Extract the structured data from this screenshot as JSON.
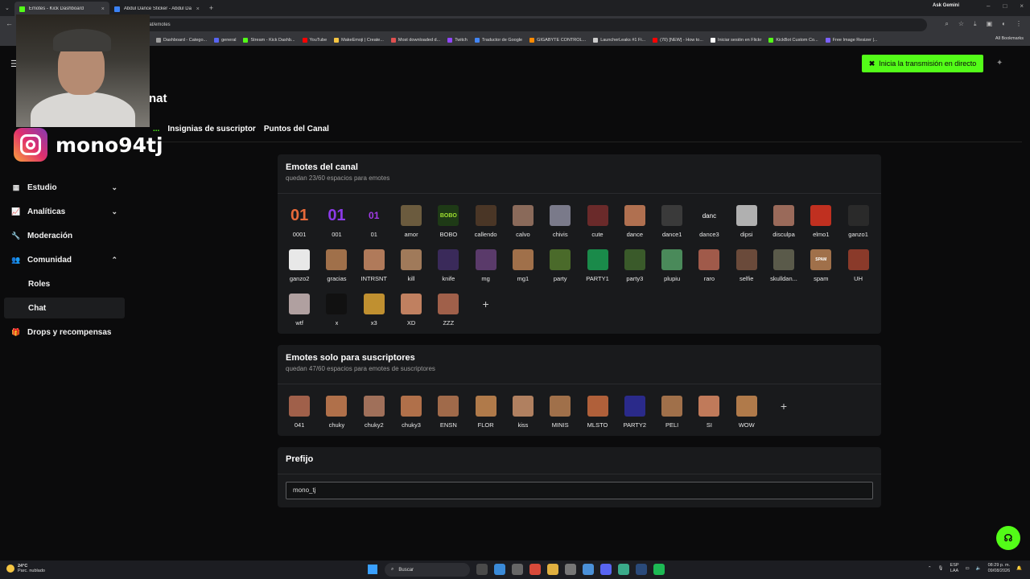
{
  "browser": {
    "tabs": [
      {
        "title": "Emotes - Kick Dashboard",
        "active": true,
        "color": "#53fc18"
      },
      {
        "title": "Abdul Dance Sticker - Abdul Da",
        "active": false,
        "color": "#3b82f6"
      }
    ],
    "new_tab": "+",
    "gemini": "Ask Gemini",
    "url": "hat/emotes",
    "bookmarks": [
      {
        "label": "Dashboard - Catego...",
        "color": "#9e9e9e"
      },
      {
        "label": "general",
        "color": "#5865f2"
      },
      {
        "label": "Stream - Kick Dashb...",
        "color": "#53fc18"
      },
      {
        "label": "YouTube",
        "color": "#ff0000"
      },
      {
        "label": "MakeEmoji | Create...",
        "color": "#f5c542"
      },
      {
        "label": "Most downloaded d...",
        "color": "#e05050"
      },
      {
        "label": "Twitch",
        "color": "#9146ff"
      },
      {
        "label": "Traductor de Google",
        "color": "#4285f4"
      },
      {
        "label": "GIGABYTE CONTROL...",
        "color": "#ff8a00"
      },
      {
        "label": "LauncherLeaks #1 Fi...",
        "color": "#cccccc"
      },
      {
        "label": "(70) [NEW] - How to...",
        "color": "#ff0000"
      },
      {
        "label": "Iniciar sesión en Flickr",
        "color": "#ffffff"
      },
      {
        "label": "KickBot Custom Co...",
        "color": "#53fc18"
      },
      {
        "label": "Free Image Resizer |...",
        "color": "#7b61ff"
      }
    ],
    "all_bookmarks": "All Bookmarks"
  },
  "header": {
    "live_button": "Inicia la transmisión en directo",
    "page_title": "nat"
  },
  "overlay": {
    "instagram_handle": "mono94tj"
  },
  "subtabs": [
    "...",
    "Insignias de suscriptor",
    "Puntos del Canal"
  ],
  "sidebar": {
    "items": [
      {
        "label": "Estudio",
        "icon": "studio-icon",
        "chevron": "⌄"
      },
      {
        "label": "Analíticas",
        "icon": "analytics-icon",
        "chevron": "⌄"
      },
      {
        "label": "Moderación",
        "icon": "wrench-icon",
        "chevron": ""
      },
      {
        "label": "Comunidad",
        "icon": "community-icon",
        "chevron": "⌃"
      }
    ],
    "sub_items": [
      {
        "label": "Roles",
        "active": false
      },
      {
        "label": "Chat",
        "active": true
      }
    ],
    "drops": {
      "label": "Drops y recompensas",
      "icon": "gift-icon"
    }
  },
  "channel_emotes": {
    "title": "Emotes del canal",
    "subtitle": "quedan 23/60 espacios para emotes",
    "items": [
      {
        "label": "0001",
        "glyph": "01",
        "color": "#e86a3a"
      },
      {
        "label": "001",
        "glyph": "01",
        "color": "#8b3ae8"
      },
      {
        "label": "01",
        "glyph": "01",
        "color": "#a23ae8"
      },
      {
        "label": "amor",
        "glyph": "",
        "color": "#6b5b3e"
      },
      {
        "label": "BOBO",
        "glyph": "BOBO",
        "color": "#1e3a16"
      },
      {
        "label": "callendo",
        "glyph": "",
        "color": "#4a3626"
      },
      {
        "label": "calvo",
        "glyph": "",
        "color": "#8a6a5a"
      },
      {
        "label": "chivis",
        "glyph": "",
        "color": "#7a7a8a"
      },
      {
        "label": "cute",
        "glyph": "",
        "color": "#6a2a2a"
      },
      {
        "label": "dance",
        "glyph": "",
        "color": "#b07050"
      },
      {
        "label": "dance1",
        "glyph": "",
        "color": "#3a3a3a"
      },
      {
        "label": "dance3",
        "glyph": "danc",
        "color": "#191a1c"
      },
      {
        "label": "dipsi",
        "glyph": "",
        "color": "#b0b0b0"
      },
      {
        "label": "disculpa",
        "glyph": "",
        "color": "#9a6a5a"
      },
      {
        "label": "elmo1",
        "glyph": "",
        "color": "#c03020"
      },
      {
        "label": "ganzo1",
        "glyph": "",
        "color": "#2a2a2a"
      },
      {
        "label": "ganzo2",
        "glyph": "",
        "color": "#e8e8e8"
      },
      {
        "label": "gracias",
        "glyph": "",
        "color": "#a0704a"
      },
      {
        "label": "INTRSNT",
        "glyph": "",
        "color": "#b07a5a"
      },
      {
        "label": "kill",
        "glyph": "",
        "color": "#a07a5a"
      },
      {
        "label": "knife",
        "glyph": "",
        "color": "#3a2a5a"
      },
      {
        "label": "mg",
        "glyph": "",
        "color": "#5a3a6a"
      },
      {
        "label": "mg1",
        "glyph": "",
        "color": "#a0704a"
      },
      {
        "label": "party",
        "glyph": "",
        "color": "#4a6a2a"
      },
      {
        "label": "PARTY1",
        "glyph": "",
        "color": "#1a8a4a"
      },
      {
        "label": "party3",
        "glyph": "",
        "color": "#3a5a2a"
      },
      {
        "label": "plupiu",
        "glyph": "",
        "color": "#4a8a5a"
      },
      {
        "label": "raro",
        "glyph": "",
        "color": "#a05a4a"
      },
      {
        "label": "selfie",
        "glyph": "",
        "color": "#6a4a3a"
      },
      {
        "label": "skulldan...",
        "glyph": "",
        "color": "#5a5a4a"
      },
      {
        "label": "spam",
        "glyph": "SPAM",
        "color": "#a0704a"
      },
      {
        "label": "UH",
        "glyph": "",
        "color": "#8a3a2a"
      },
      {
        "label": "wtf",
        "glyph": "",
        "color": "#b0a0a0"
      },
      {
        "label": "x",
        "glyph": "",
        "color": "#111111"
      },
      {
        "label": "x3",
        "glyph": "",
        "color": "#c09030"
      },
      {
        "label": "XD",
        "glyph": "",
        "color": "#c08060"
      },
      {
        "label": "ZZZ",
        "glyph": "",
        "color": "#a0604a"
      }
    ],
    "add": "+"
  },
  "sub_emotes": {
    "title": "Emotes solo para suscriptores",
    "subtitle": "quedan 47/60 espacios para emotes de suscriptores",
    "items": [
      {
        "label": "041",
        "glyph": "",
        "color": "#a0604a"
      },
      {
        "label": "chuky",
        "glyph": "",
        "color": "#b0704a"
      },
      {
        "label": "chuky2",
        "glyph": "",
        "color": "#a0705a"
      },
      {
        "label": "chuky3",
        "glyph": "",
        "color": "#b0704a"
      },
      {
        "label": "ENSN",
        "glyph": "",
        "color": "#a06a4a"
      },
      {
        "label": "FLOR",
        "glyph": "",
        "color": "#b07a4a"
      },
      {
        "label": "kiss",
        "glyph": "",
        "color": "#b08060"
      },
      {
        "label": "MINIS",
        "glyph": "",
        "color": "#a0704a"
      },
      {
        "label": "MLSTO",
        "glyph": "",
        "color": "#b0603a"
      },
      {
        "label": "PARTY2",
        "glyph": "",
        "color": "#2a2a8a"
      },
      {
        "label": "PELI",
        "glyph": "",
        "color": "#a0704a"
      },
      {
        "label": "SI",
        "glyph": "",
        "color": "#c07a5a"
      },
      {
        "label": "WOW",
        "glyph": "",
        "color": "#b07a4a"
      }
    ],
    "add": "+"
  },
  "prefix": {
    "title": "Prefijo",
    "value": "mono_tj"
  },
  "taskbar": {
    "weather_temp": "24°C",
    "weather_desc": "Parc. nublado",
    "search_label": "Buscar",
    "lang_top": "ESP",
    "lang_bottom": "LAA",
    "time": "08:29 p. m.",
    "date": "09/08/2026"
  },
  "colors": {
    "accent": "#53fc18",
    "background": "#0b0b0c",
    "panel": "#191a1c"
  }
}
